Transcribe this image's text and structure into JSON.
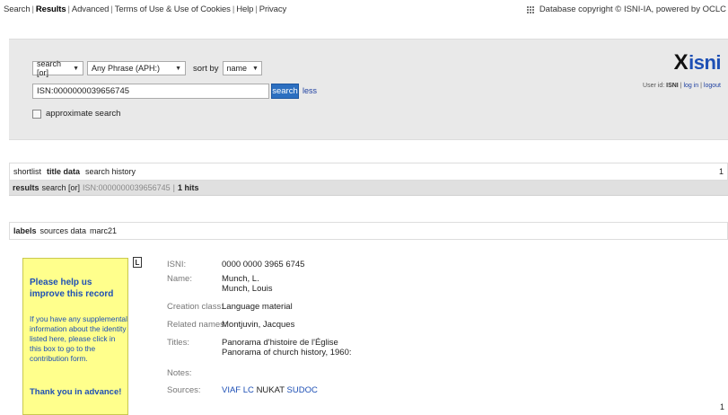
{
  "topnav": {
    "items": [
      "Search",
      "Results",
      "Advanced",
      "Terms of Use & Use of Cookies",
      "Help",
      "Privacy"
    ],
    "current": "Results"
  },
  "copyright": "Database copyright © ISNI-IA, powered by OCLC",
  "search": {
    "operator": "search [or]",
    "field": "Any Phrase (APH:)",
    "sort_label": "sort by",
    "sort_value": "name",
    "query": "ISN:0000000039656745",
    "button": "search",
    "less": "less",
    "approx_label": "approximate search"
  },
  "logo": {
    "x": "X",
    "text": "isni"
  },
  "user": {
    "prefix": "User id:",
    "id": "ISNI",
    "login": "log in",
    "logout": "logout"
  },
  "tabs1": {
    "items": [
      "shortlist",
      "title data",
      "search history"
    ],
    "active": "title data",
    "page": "1"
  },
  "results": {
    "label": "results",
    "op": "search [or]",
    "query": "ISN:0000000039656745",
    "hits": "1 hits"
  },
  "tabs2": {
    "items": [
      "labels",
      "sources data",
      "marc21"
    ],
    "active": "labels"
  },
  "help": {
    "title": "Please help us improve this record",
    "text": "If you have any supplemental information about the identity listed here, please click in this box to go to the contribution form.",
    "thanks": "Thank you in advance!"
  },
  "record": {
    "icon": "L",
    "isni_label": "ISNI:",
    "isni": "0000 0000 3965 6745",
    "name_label": "Name:",
    "names": [
      "Munch, L.",
      "Munch, Louis"
    ],
    "class_label": "Creation class:",
    "class": "Language material",
    "related_label": "Related names:",
    "related": "Montjuvin, Jacques",
    "titles_label": "Titles:",
    "titles": [
      "Panorama d'histoire de l'Église",
      "Panorama of church history, 1960:"
    ],
    "notes_label": "Notes:",
    "sources_label": "Sources:",
    "sources": [
      "VIAF",
      "LC",
      "NUKAT",
      "SUDOC"
    ]
  },
  "page_bottom": "1"
}
